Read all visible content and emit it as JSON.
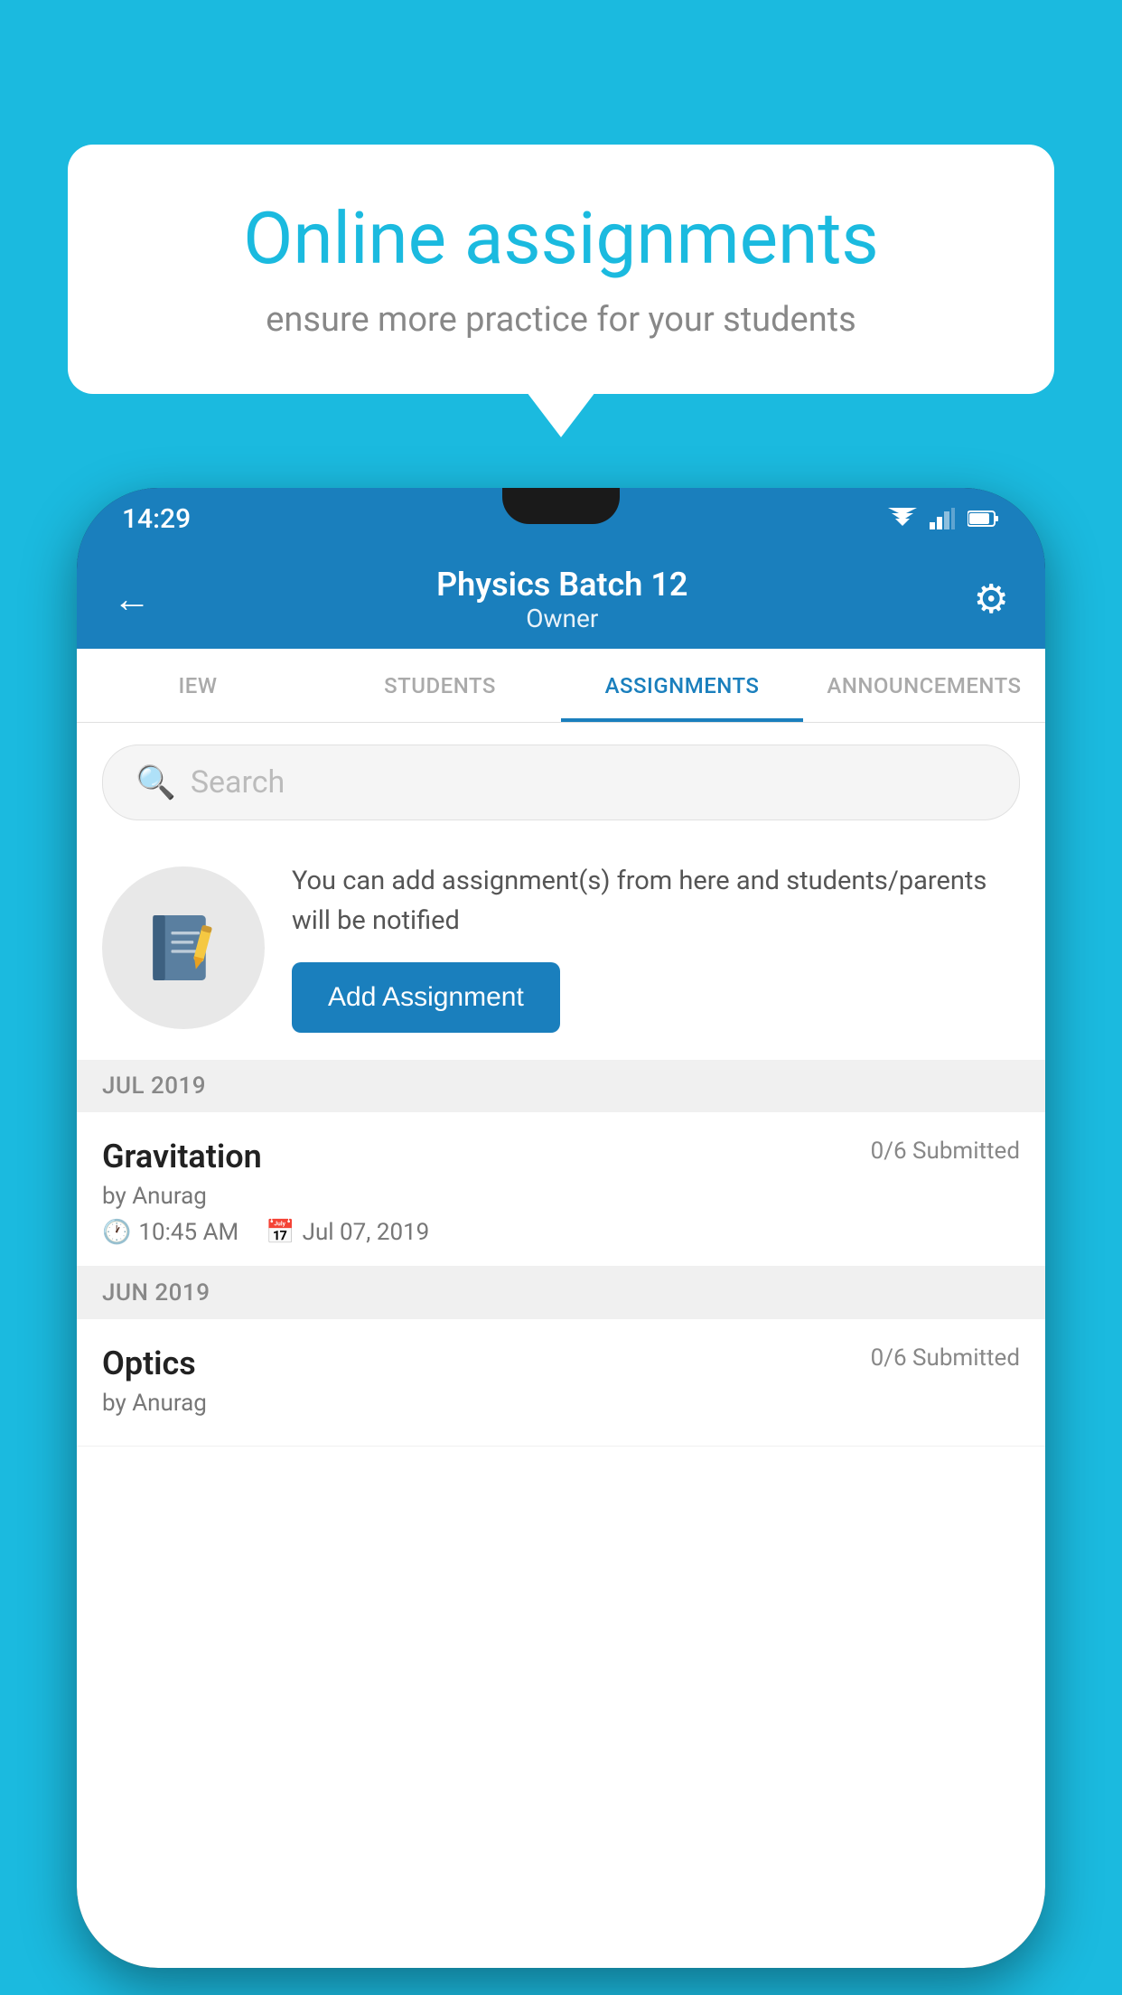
{
  "background": {
    "color": "#1BBADF"
  },
  "speech_bubble": {
    "title": "Online assignments",
    "subtitle": "ensure more practice for your students"
  },
  "phone": {
    "status_bar": {
      "time": "14:29"
    },
    "header": {
      "title": "Physics Batch 12",
      "subtitle": "Owner",
      "back_label": "←",
      "gear_label": "⚙"
    },
    "tabs": [
      {
        "label": "IEW",
        "active": false
      },
      {
        "label": "STUDENTS",
        "active": false
      },
      {
        "label": "ASSIGNMENTS",
        "active": true
      },
      {
        "label": "ANNOUNCEMENTS",
        "active": false
      }
    ],
    "search": {
      "placeholder": "Search"
    },
    "info_section": {
      "description": "You can add assignment(s) from here and students/parents will be notified",
      "button_label": "Add Assignment"
    },
    "months": [
      {
        "label": "JUL 2019",
        "assignments": [
          {
            "name": "Gravitation",
            "submitted": "0/6 Submitted",
            "by": "by Anurag",
            "time": "10:45 AM",
            "date": "Jul 07, 2019"
          }
        ]
      },
      {
        "label": "JUN 2019",
        "assignments": [
          {
            "name": "Optics",
            "submitted": "0/6 Submitted",
            "by": "by Anurag",
            "time": "",
            "date": ""
          }
        ]
      }
    ]
  }
}
